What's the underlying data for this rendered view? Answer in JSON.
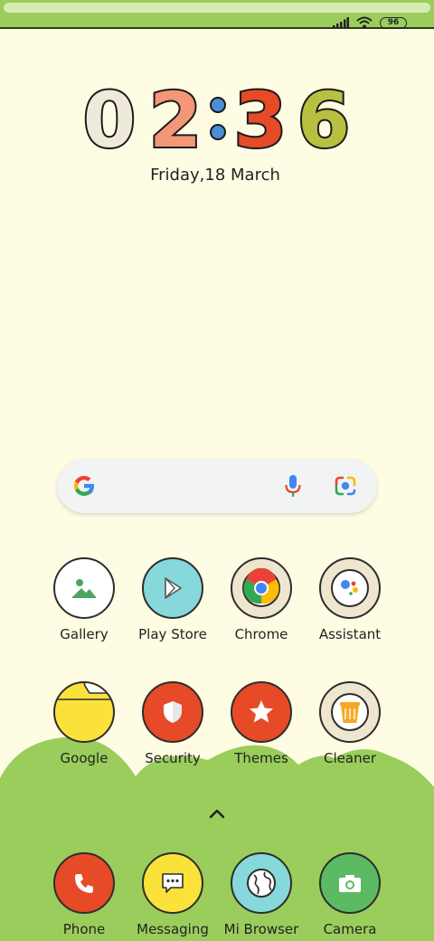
{
  "status": {
    "battery": "96"
  },
  "clock": {
    "digits": [
      "0",
      "2",
      "3",
      "6"
    ]
  },
  "date": "Friday,18 March",
  "colors": {
    "background": "#fefde3",
    "grass": "#9acd5c",
    "accent_red": "#e64a26",
    "accent_yellow": "#fbe23b",
    "accent_cyan": "#86d8da",
    "accent_green": "#5cba62"
  },
  "apps": {
    "row1": [
      {
        "label": "Gallery",
        "icon": "gallery-icon"
      },
      {
        "label": "Play Store",
        "icon": "play-store-icon"
      },
      {
        "label": "Chrome",
        "icon": "chrome-icon"
      },
      {
        "label": "Assistant",
        "icon": "assistant-icon"
      }
    ],
    "row2": [
      {
        "label": "Google",
        "icon": "folder-icon"
      },
      {
        "label": "Security",
        "icon": "shield-icon"
      },
      {
        "label": "Themes",
        "icon": "star-icon"
      },
      {
        "label": "Cleaner",
        "icon": "trash-icon"
      }
    ],
    "dock": [
      {
        "label": "Phone",
        "icon": "phone-icon"
      },
      {
        "label": "Messaging",
        "icon": "message-icon"
      },
      {
        "label": "Mi Browser",
        "icon": "globe-icon"
      },
      {
        "label": "Camera",
        "icon": "camera-icon"
      }
    ]
  }
}
